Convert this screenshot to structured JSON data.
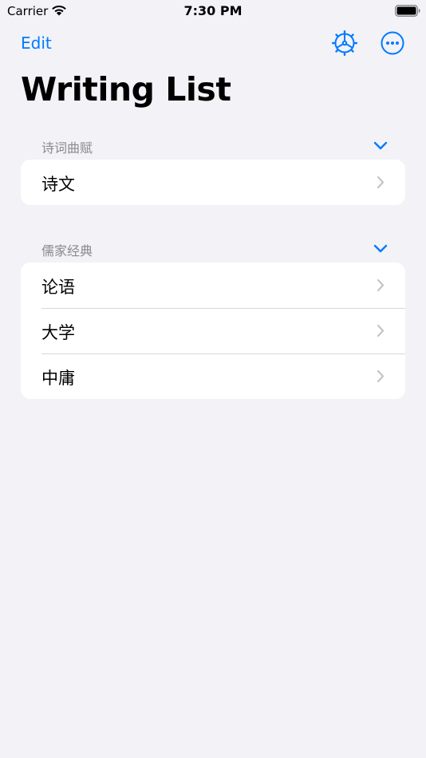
{
  "status_bar": {
    "carrier": "Carrier",
    "time": "7:30 PM"
  },
  "nav": {
    "edit_label": "Edit",
    "icons": [
      "ship-wheel-icon",
      "more-icon"
    ]
  },
  "title": "Writing List",
  "sections": [
    {
      "header": "诗词曲赋",
      "items": [
        {
          "label": "诗文"
        }
      ]
    },
    {
      "header": "儒家经典",
      "items": [
        {
          "label": "论语"
        },
        {
          "label": "大学"
        },
        {
          "label": "中庸"
        }
      ]
    }
  ],
  "colors": {
    "accent": "#007aff",
    "background": "#f2f2f7",
    "card": "#ffffff",
    "secondary_text": "#8a8a8e",
    "chevron": "#c4c4c7"
  }
}
